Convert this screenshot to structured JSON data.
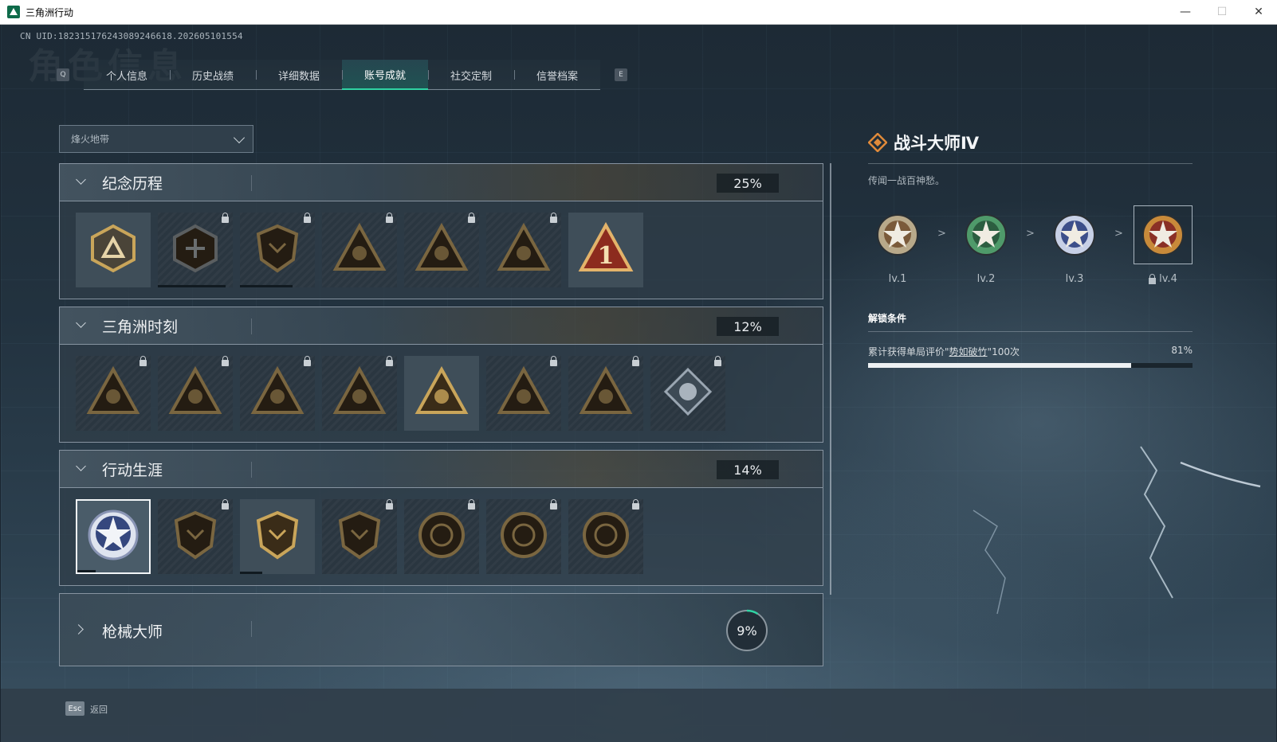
{
  "window": {
    "title": "三角洲行动",
    "minimize": "—",
    "maximize": "☐",
    "close": "✕"
  },
  "header": {
    "uid": "CN UID:182315176243089246618.202605101554",
    "bg_title": "角色信息",
    "key_left": "Q",
    "key_right": "E"
  },
  "tabs": [
    {
      "label": "个人信息",
      "active": false
    },
    {
      "label": "历史战绩",
      "active": false
    },
    {
      "label": "详细数据",
      "active": false
    },
    {
      "label": "账号成就",
      "active": true
    },
    {
      "label": "社交定制",
      "active": false
    },
    {
      "label": "信誉档案",
      "active": false
    }
  ],
  "mode_dropdown": {
    "value": "烽火地带"
  },
  "sections": [
    {
      "name": "纪念历程",
      "percent": "25%",
      "expanded": true,
      "tiles": [
        {
          "icon": "triangle-emblem-icon",
          "locked": false,
          "progress": 0
        },
        {
          "icon": "helicopter-emblem-icon",
          "locked": true,
          "progress": 0.9
        },
        {
          "icon": "hex-shield-emblem-icon",
          "locked": true,
          "progress": 0.7
        },
        {
          "icon": "soldier-triangle-icon",
          "locked": true,
          "progress": 0
        },
        {
          "icon": "portrait-triangle-icon",
          "locked": true,
          "progress": 0
        },
        {
          "icon": "operator-triangle-icon",
          "locked": true,
          "progress": 0
        },
        {
          "icon": "rank-one-triangle-icon",
          "locked": false,
          "progress": 0
        }
      ]
    },
    {
      "name": "三角洲时刻",
      "percent": "12%",
      "expanded": true,
      "tiles": [
        {
          "icon": "robot-triangle-icon",
          "locked": true,
          "progress": 0
        },
        {
          "icon": "mask-triangle-icon",
          "locked": true,
          "progress": 0
        },
        {
          "icon": "crouch-triangle-icon",
          "locked": true,
          "progress": 0
        },
        {
          "icon": "gear-hands-triangle-icon",
          "locked": true,
          "progress": 0
        },
        {
          "icon": "squad-triangle-icon",
          "locked": false,
          "progress": 0
        },
        {
          "icon": "team-triangle-icon",
          "locked": true,
          "progress": 0
        },
        {
          "icon": "dragon-triangle-icon",
          "locked": true,
          "progress": 0
        },
        {
          "icon": "rose-diamond-icon",
          "locked": true,
          "progress": 0
        }
      ]
    },
    {
      "name": "行动生涯",
      "percent": "14%",
      "expanded": true,
      "tiles": [
        {
          "icon": "star-medal-icon",
          "locked": false,
          "selected": true,
          "progress": 0.25
        },
        {
          "icon": "chevron-shield-icon",
          "locked": true,
          "progress": 0
        },
        {
          "icon": "split-shield-icon",
          "locked": false,
          "progress": 0.3
        },
        {
          "icon": "gem-shield-icon",
          "locked": true,
          "progress": 0
        },
        {
          "icon": "orbit-coin-icon",
          "locked": true,
          "progress": 0
        },
        {
          "icon": "sniper-coin-icon",
          "locked": true,
          "progress": 0
        },
        {
          "icon": "eye-coin-icon",
          "locked": true,
          "progress": 0
        }
      ]
    },
    {
      "name": "枪械大师",
      "percent": "9%",
      "progress": 0.09,
      "expanded": false
    }
  ],
  "detail": {
    "title": "战斗大师Ⅳ",
    "description": "传闻一战百神愁。",
    "levels": [
      {
        "label": "lv.1",
        "color": "#b8a98a",
        "inner": "#7a5a3a",
        "locked": false
      },
      {
        "label": "lv.2",
        "color": "#4f9a6a",
        "inner": "#2c5d40",
        "locked": false
      },
      {
        "label": "lv.3",
        "color": "#c7d0e6",
        "inner": "#3d4f8a",
        "locked": false
      },
      {
        "label": "lv.4",
        "color": "#c88a3a",
        "inner": "#8a3026",
        "locked": true,
        "current": true
      }
    ],
    "arrow": ">",
    "condition_title": "解锁条件",
    "condition_prefix": "累计获得单局评价\"",
    "condition_link": "势如破竹",
    "condition_suffix": "\"100次",
    "condition_percent": "81%",
    "condition_progress": 0.81
  },
  "footer": {
    "esc_key": "Esc",
    "back_label": "返回"
  }
}
